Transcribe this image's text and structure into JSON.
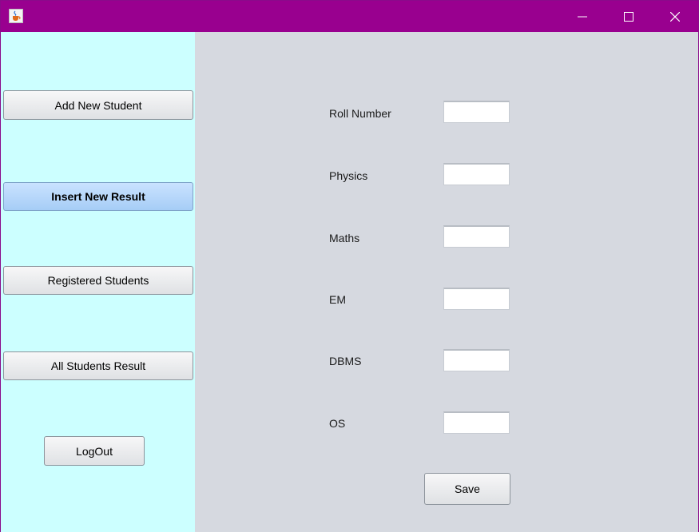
{
  "colors": {
    "titlebar": "#99008f",
    "sidebar": "#ccffff",
    "main": "#d6d9e0",
    "active_button": "#b4d6fb"
  },
  "window": {
    "icon": "java-cup-icon",
    "controls": [
      "minimize-icon",
      "maximize-icon",
      "close-icon"
    ]
  },
  "sidebar": {
    "items": [
      {
        "label": "Add New Student",
        "active": false
      },
      {
        "label": "Insert New Result",
        "active": true
      },
      {
        "label": "Registered Students",
        "active": false
      },
      {
        "label": "All Students Result",
        "active": false
      }
    ],
    "logout_label": "LogOut"
  },
  "form": {
    "fields": [
      {
        "label": "Roll Number",
        "value": ""
      },
      {
        "label": "Physics",
        "value": ""
      },
      {
        "label": "Maths",
        "value": ""
      },
      {
        "label": "EM",
        "value": ""
      },
      {
        "label": "DBMS",
        "value": ""
      },
      {
        "label": "OS",
        "value": ""
      }
    ],
    "save_label": "Save"
  }
}
